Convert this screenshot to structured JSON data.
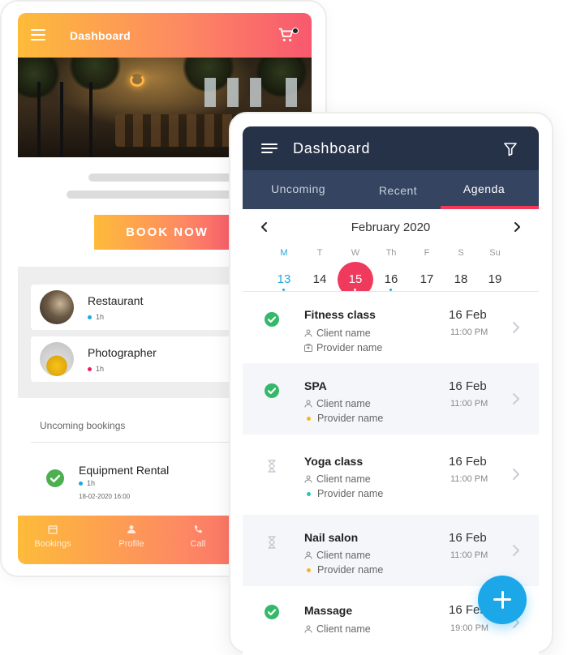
{
  "back_app": {
    "header_title": "Dashboard",
    "cart_icon": "cart-icon",
    "book_button_label": "BOOK NOW",
    "categories": [
      {
        "name": "Restaurant",
        "time": "1h",
        "dot_color": "#1ba7e8"
      },
      {
        "name": "Photographer",
        "time": "1h",
        "dot_color": "#e91e63"
      }
    ],
    "upcoming_label": "Uncoming bookings",
    "upcoming": {
      "title": "Equipment Rental",
      "time": "1h",
      "date": "18-02-2020 16:00"
    },
    "tabbar": [
      {
        "label": "Bookings",
        "icon": "calendar-icon"
      },
      {
        "label": "Profile",
        "icon": "person-icon"
      },
      {
        "label": "Call",
        "icon": "phone-icon"
      }
    ],
    "accent_gradient": [
      "#fdbb3a",
      "#fd8a62",
      "#f8586f"
    ]
  },
  "front_app": {
    "header_title": "Dashboard",
    "tabs": [
      {
        "label": "Uncoming"
      },
      {
        "label": "Recent"
      },
      {
        "label": "Agenda"
      }
    ],
    "active_tab": "Agenda",
    "month": "February 2020",
    "weekdays": [
      "M",
      "T",
      "W",
      "Th",
      "F",
      "S",
      "Su"
    ],
    "days": [
      "13",
      "14",
      "15",
      "16",
      "17",
      "18",
      "19"
    ],
    "selected_day": "15",
    "today": "13",
    "bookings": [
      {
        "name": "Fitness class",
        "client": "Client name",
        "provider": "Provider name",
        "provider_icon": "provider-icon",
        "date": "16 Feb",
        "time": "11:00 PM",
        "status": "confirmed"
      },
      {
        "name": "SPA",
        "client": "Client name",
        "provider": "Provider name",
        "provider_dot": "#f5b81c",
        "date": "16 Feb",
        "time": "11:00 PM",
        "status": "confirmed"
      },
      {
        "name": "Yoga class",
        "client": "Client name",
        "provider": "Provider name",
        "provider_dot": "#26c6b0",
        "date": "16 Feb",
        "time": "11:00 PM",
        "status": "pending"
      },
      {
        "name": "Nail salon",
        "client": "Client name",
        "provider": "Provider name",
        "provider_dot": "#f5b81c",
        "date": "16 Feb",
        "time": "11:00 PM",
        "status": "pending"
      },
      {
        "name": "Massage",
        "client": "Client name",
        "date": "16 Feb",
        "time": "19:00 PM",
        "status": "confirmed"
      }
    ],
    "header_color": "#263248",
    "tabs_color": "#354461",
    "accent_color": "#ef3a5d",
    "fab_color": "#1ba7e8"
  }
}
